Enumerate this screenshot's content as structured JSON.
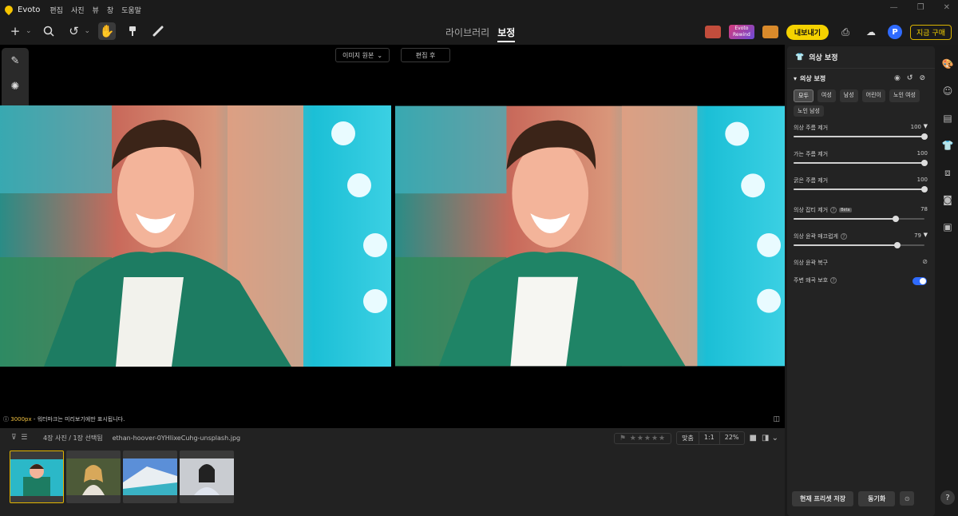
{
  "app": {
    "name": "Evoto",
    "menu": [
      "편집",
      "사진",
      "뷰",
      "창",
      "도움말"
    ]
  },
  "mode_tabs": [
    {
      "label": "라이브러리",
      "active": false
    },
    {
      "label": "보정",
      "active": true
    }
  ],
  "toolbar": {
    "rewind_label": "Evoto Rewind",
    "export_label": "내보내기",
    "avatar_letter": "P",
    "buy_label": "지금 구매"
  },
  "canvas": {
    "view_original_label": "이미지 원본",
    "view_after_label": "편집 후",
    "note_prefix": "3000px",
    "note_text": " - 워터마크는 미리보기에만 표시됩니다."
  },
  "filmstrip": {
    "count_text": "4장 사진 / 1장 선택됨",
    "filename": "ethan-hoover-0YHIixeCuhg-unsplash.jpg",
    "fit_label": "맞춤",
    "ratio_label": "1:1",
    "zoom_label": "22%",
    "thumb_count": 4
  },
  "panel": {
    "title": "의상 보정",
    "section_title": "의상 보정",
    "chips": [
      "모두",
      "여성",
      "남성",
      "어린이",
      "노인 여성",
      "노인 남성"
    ],
    "sliders": [
      {
        "label": "의상 주름 제거",
        "value": 100,
        "caret": true
      },
      {
        "label": "가는 주름 제거",
        "value": 100,
        "caret": false
      },
      {
        "label": "굵은 주름 제거",
        "value": 100,
        "caret": false
      },
      {
        "label": "의상 잡티 제거",
        "value": 78,
        "caret": false,
        "beta": "Beta"
      },
      {
        "label": "의상 윤곽 매끄럽게",
        "value": 79,
        "caret": true
      }
    ],
    "restore_label": "의상 윤곽 복구",
    "protect_label": "주변 왜곡 보호",
    "protect_on": true,
    "save_preset_label": "현재 프리셋 저장",
    "sync_label": "동기화"
  },
  "colors": {
    "accent": "#f5d200",
    "toggle": "#2f6bff"
  }
}
